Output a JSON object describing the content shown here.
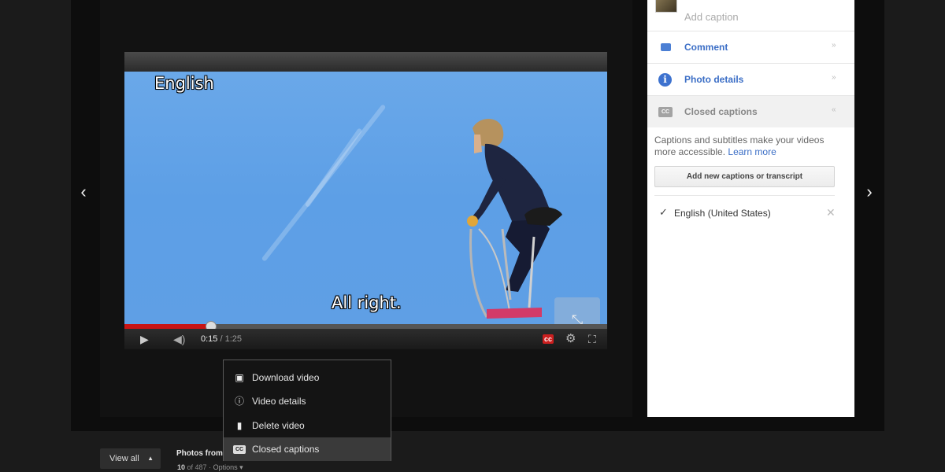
{
  "nav": {
    "prev_glyph": "‹",
    "next_glyph": "›"
  },
  "player": {
    "caption_language": "English",
    "caption_line": "All right.",
    "current_time": "0:15",
    "separator": " / ",
    "duration": "1:25",
    "progress_fraction": 0.18,
    "cc_label": "cc",
    "icons": {
      "play": "play-icon",
      "volume": "volume-icon",
      "settings": "gear-icon",
      "fullscreen": "fullscreen-icon",
      "expand": "expand-icon"
    },
    "colors": {
      "progress": "#c81414",
      "cc_badge": "#cc1f1f"
    }
  },
  "options_menu": {
    "items": [
      {
        "label": "Download video",
        "icon": "download-icon"
      },
      {
        "label": "Video details",
        "icon": "info-icon"
      },
      {
        "label": "Delete video",
        "icon": "trash-icon"
      },
      {
        "label": "Closed captions",
        "icon": "cc-icon",
        "cc_glyph": "CC",
        "selected": true
      }
    ]
  },
  "bottom_bar": {
    "view_all": "View all",
    "view_all_chevron": "▲",
    "photos_from": "Photos from",
    "counter_current": "10",
    "counter_of": " of ",
    "counter_total": "487",
    "counter_dot": " · ",
    "options": "Options",
    "options_chevron": " ▾"
  },
  "panel": {
    "add_caption": "Add caption",
    "sections": {
      "comment": {
        "label": "Comment",
        "chevron": "»"
      },
      "photo_details": {
        "label": "Photo details",
        "chevron": "»",
        "icon_glyph": "i"
      },
      "closed_captions": {
        "label": "Closed captions",
        "chevron": "«",
        "icon_glyph": "CC"
      }
    },
    "cc_description": "Captions and subtitles make your videos more accessible.",
    "learn_more": "Learn more",
    "add_captions_button": "Add new captions or transcript",
    "tracks": [
      {
        "label": "English (United States)",
        "checked_glyph": "✓",
        "remove_glyph": "✕"
      }
    ],
    "colors": {
      "link": "#3b6ec6",
      "accent_icon": "#3d72cf"
    }
  }
}
